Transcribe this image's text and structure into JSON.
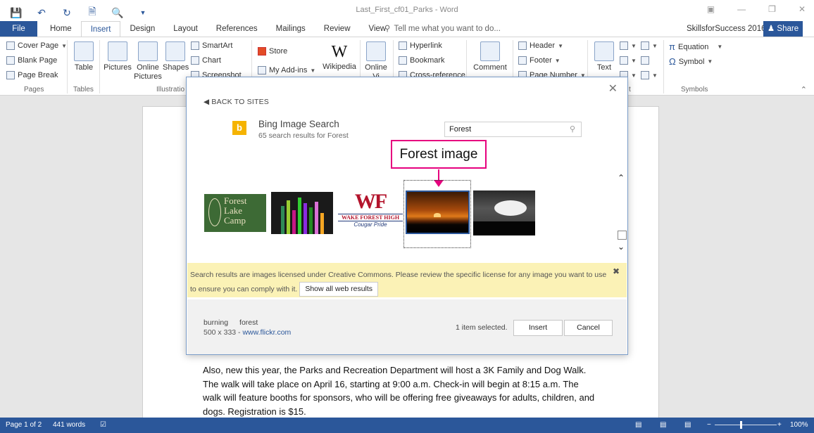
{
  "app": {
    "document_title": "Last_First_cf01_Parks - Word"
  },
  "quick_access": {
    "save_icon": "save-icon",
    "undo_icon": "undo-icon",
    "redo_icon": "redo-icon"
  },
  "tabs": {
    "file": "File",
    "items": [
      "Home",
      "Insert",
      "Design",
      "Layout",
      "References",
      "Mailings",
      "Review",
      "View"
    ],
    "active": "Insert",
    "tell_me": "Tell me what you want to do...",
    "account": "SkillsforSuccess 2016",
    "share": "Share"
  },
  "ribbon": {
    "pages": {
      "label": "Pages",
      "cover_page": "Cover Page",
      "blank_page": "Blank Page",
      "page_break": "Page Break"
    },
    "tables": {
      "label": "Tables",
      "table": "Table"
    },
    "illustrations": {
      "label": "Illustratio",
      "pictures": "Pictures",
      "online_pictures_1": "Online",
      "online_pictures_2": "Pictures",
      "shapes": "Shapes",
      "smartart": "SmartArt",
      "chart": "Chart",
      "screenshot": "Screenshot"
    },
    "addins": {
      "store": "Store",
      "my_addins": "My Add-ins",
      "wikipedia": "Wikipedia"
    },
    "media": {
      "online_video_1": "Online",
      "online_video_2": "Vi"
    },
    "links": {
      "hyperlink": "Hyperlink",
      "bookmark": "Bookmark",
      "cross_reference": "Cross-reference"
    },
    "comments": {
      "comment": "Comment"
    },
    "header_footer": {
      "header": "Header",
      "footer": "Footer",
      "page_number": "Page Number"
    },
    "text": {
      "text_box_1": "Text",
      "text_box_2": "t"
    },
    "symbols": {
      "label": "Symbols",
      "equation": "Equation",
      "symbol": "Symbol"
    }
  },
  "dialog": {
    "back": "BACK TO SITES",
    "source_title": "Bing Image Search",
    "results_summary": "65 search results for Forest",
    "search_value": "Forest",
    "callout": "Forest image",
    "thumbs": {
      "t1_text": "Forest Lake Camp",
      "t3_logo": "WF",
      "t3_line": "WAKE FOREST HIGH",
      "t3_sub": "Cougar Pride"
    },
    "notice": "Search results are images licensed under Creative Commons. Please review the specific license for any image you want to use to ensure you can comply with it.",
    "show_all": "Show all web results",
    "tag1": "burning",
    "tag2": "forest",
    "image_size": "500 x 333 - ",
    "image_source": "www.flickr.com",
    "selected": "1 item selected.",
    "insert": "Insert",
    "cancel": "Cancel"
  },
  "document": {
    "paragraph": "Also, new this year, the Parks and Recreation Department will host a 3K Family and Dog Walk. The walk will take place on April 16, starting at 9:00 a.m. Check-in will begin at 8:15 a.m. The walk will feature booths for sponsors, who will be offering free giveaways for adults, children, and dogs. Registration is $15."
  },
  "status": {
    "page": "Page 1 of 2",
    "words": "441 words",
    "zoom": "100%"
  },
  "colors": {
    "accent": "#2b579a",
    "callout": "#e6007e",
    "notice_bg": "#fbf2b6"
  }
}
